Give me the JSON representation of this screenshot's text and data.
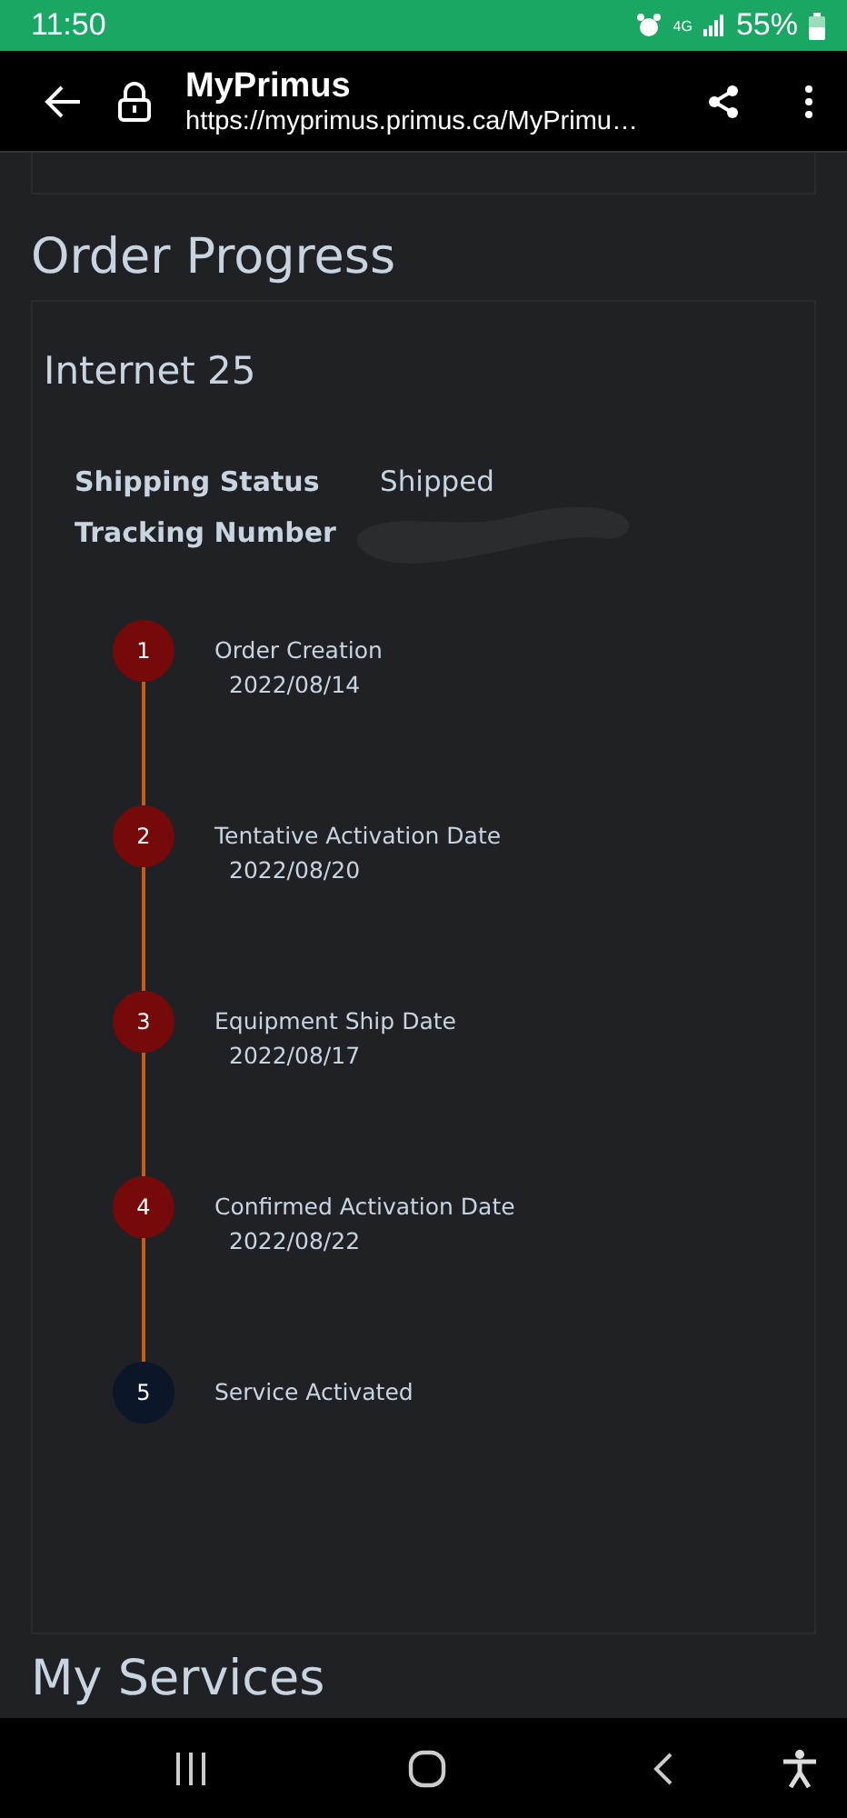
{
  "status_bar": {
    "time": "11:50",
    "network": "4G",
    "battery": "55%"
  },
  "browser": {
    "title": "MyPrimus",
    "url": "https://myprimus.primus.ca/MyPrimu…"
  },
  "heading": "Order Progress",
  "order": {
    "title": "Internet 25",
    "details": [
      {
        "label": "Shipping Status",
        "value": "Shipped",
        "redacted": false
      },
      {
        "label": "Tracking Number",
        "redacted": true
      }
    ],
    "steps": [
      {
        "number": "1",
        "label": "Order Creation",
        "date": "2022/08/14",
        "completed": true
      },
      {
        "number": "2",
        "label": "Tentative Activation Date",
        "date": "2022/08/20",
        "completed": true
      },
      {
        "number": "3",
        "label": "Equipment Ship Date",
        "date": "2022/08/17",
        "completed": true
      },
      {
        "number": "4",
        "label": "Confirmed Activation Date",
        "date": "2022/08/22",
        "completed": true
      },
      {
        "number": "5",
        "label": "Service Activated",
        "completed": false
      }
    ]
  },
  "next_heading": "My Services"
}
